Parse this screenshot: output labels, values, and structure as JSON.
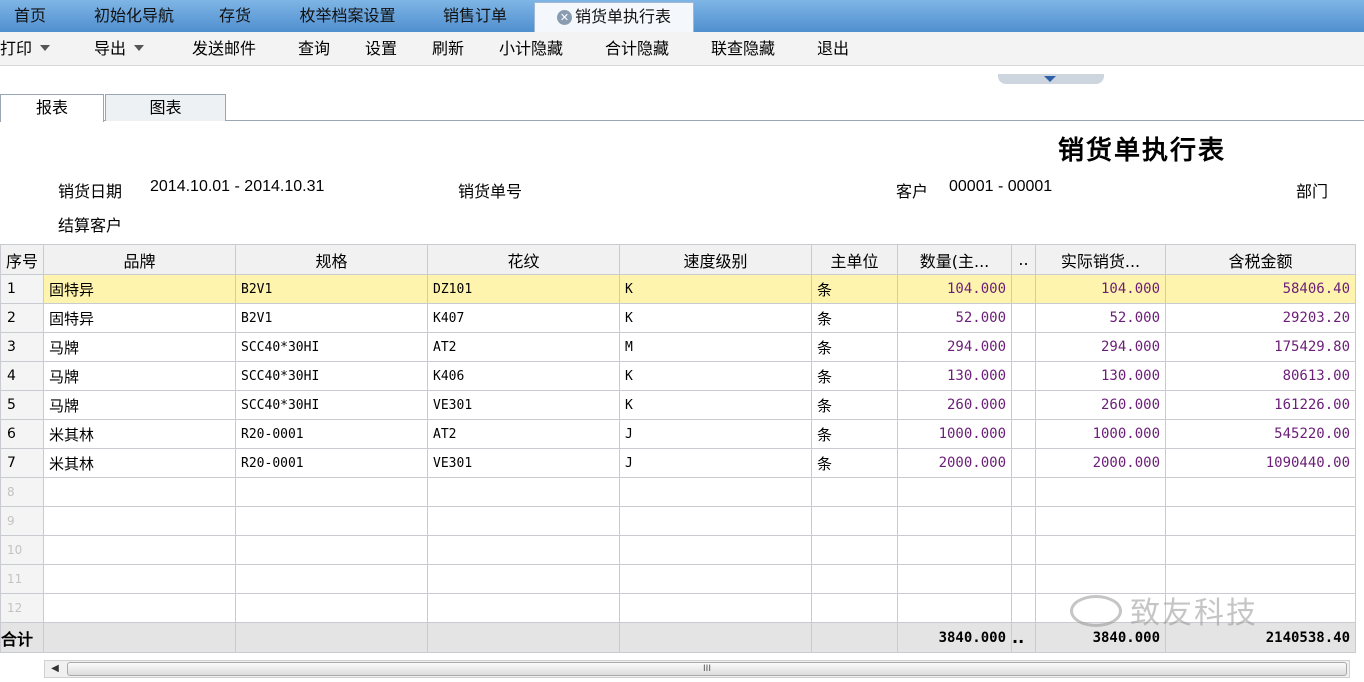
{
  "tabs": [
    {
      "label": "首页"
    },
    {
      "label": "初始化导航"
    },
    {
      "label": "存货"
    },
    {
      "label": "枚举档案设置"
    },
    {
      "label": "销售订单"
    },
    {
      "label": "销货单执行表"
    }
  ],
  "toolbar": {
    "print": "打印",
    "export": "导出",
    "send_mail": "发送邮件",
    "query": "查询",
    "settings": "设置",
    "refresh": "刷新",
    "hide_subtotal": "小计隐藏",
    "hide_total": "合计隐藏",
    "hide_linked": "联查隐藏",
    "exit": "退出"
  },
  "view_tabs": {
    "report": "报表",
    "chart": "图表"
  },
  "report": {
    "title": "销货单执行表",
    "date_label": "销货日期",
    "date_value": "2014.10.01 - 2014.10.31",
    "order_no_label": "销货单号",
    "customer_label": "客户",
    "customer_value": "00001 - 00001",
    "dept_label": "部门",
    "settle_label": "结算客户"
  },
  "grid": {
    "headers": {
      "seq": "序号",
      "brand": "品牌",
      "spec": "规格",
      "pattern": "花纹",
      "speed": "速度级别",
      "unit": "主单位",
      "qty": "数量(主...",
      "gap": "..",
      "actual": "实际销货...",
      "amount": "含税金额"
    },
    "rows": [
      {
        "seq": "1",
        "brand": "固特异",
        "spec": "B2V1",
        "pattern": "DZ101",
        "speed": "K",
        "unit": "条",
        "qty": "104.000",
        "actual": "104.000",
        "amount": "58406.40"
      },
      {
        "seq": "2",
        "brand": "固特异",
        "spec": "B2V1",
        "pattern": "K407",
        "speed": "K",
        "unit": "条",
        "qty": "52.000",
        "actual": "52.000",
        "amount": "29203.20"
      },
      {
        "seq": "3",
        "brand": "马牌",
        "spec": "SCC40*30HI",
        "pattern": "AT2",
        "speed": "M",
        "unit": "条",
        "qty": "294.000",
        "actual": "294.000",
        "amount": "175429.80"
      },
      {
        "seq": "4",
        "brand": "马牌",
        "spec": "SCC40*30HI",
        "pattern": "K406",
        "speed": "K",
        "unit": "条",
        "qty": "130.000",
        "actual": "130.000",
        "amount": "80613.00"
      },
      {
        "seq": "5",
        "brand": "马牌",
        "spec": "SCC40*30HI",
        "pattern": "VE301",
        "speed": "K",
        "unit": "条",
        "qty": "260.000",
        "actual": "260.000",
        "amount": "161226.00"
      },
      {
        "seq": "6",
        "brand": "米其林",
        "spec": "R20-0001",
        "pattern": "AT2",
        "speed": "J",
        "unit": "条",
        "qty": "1000.000",
        "actual": "1000.000",
        "amount": "545220.00"
      },
      {
        "seq": "7",
        "brand": "米其林",
        "spec": "R20-0001",
        "pattern": "VE301",
        "speed": "J",
        "unit": "条",
        "qty": "2000.000",
        "actual": "2000.000",
        "amount": "1090440.00"
      }
    ],
    "empty_rows": [
      "8",
      "9",
      "10",
      "11",
      "12"
    ],
    "total": {
      "label": "合计",
      "qty": "3840.000",
      "gap": "..",
      "actual": "3840.000",
      "amount": "2140538.40"
    }
  },
  "scrollbar": {
    "grip": "III"
  },
  "watermark": "致友科技",
  "colors": {
    "tab_bar": "#5b9bd5",
    "selected_row": "#fff4ad",
    "amount_text": "#6b1e78"
  }
}
